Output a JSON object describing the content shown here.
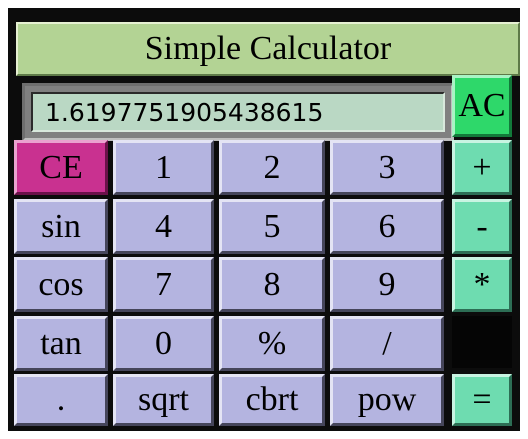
{
  "title": "Simple Calculator",
  "display": {
    "value": "1.6197751905438615"
  },
  "buttons": {
    "ac": "AC",
    "ce": "CE",
    "one": "1",
    "two": "2",
    "three": "3",
    "four": "4",
    "five": "5",
    "six": "6",
    "seven": "7",
    "eight": "8",
    "nine": "9",
    "zero": "0",
    "plus": "+",
    "minus": "-",
    "multiply": "*",
    "equals": "=",
    "sin": "sin",
    "cos": "cos",
    "tan": "tan",
    "percent": "%",
    "divide": "/",
    "decimal": ".",
    "sqrt": "sqrt",
    "cbrt": "cbrt",
    "pow": "pow"
  },
  "colors": {
    "title_bg": "#b3d394",
    "display_bg": "#bad8c4",
    "number_key": "#b4b4e0",
    "operator_key": "#6edcb0",
    "ac_key": "#2ed86a",
    "ce_key": "#c93190",
    "frame": "#0c0c0c"
  }
}
